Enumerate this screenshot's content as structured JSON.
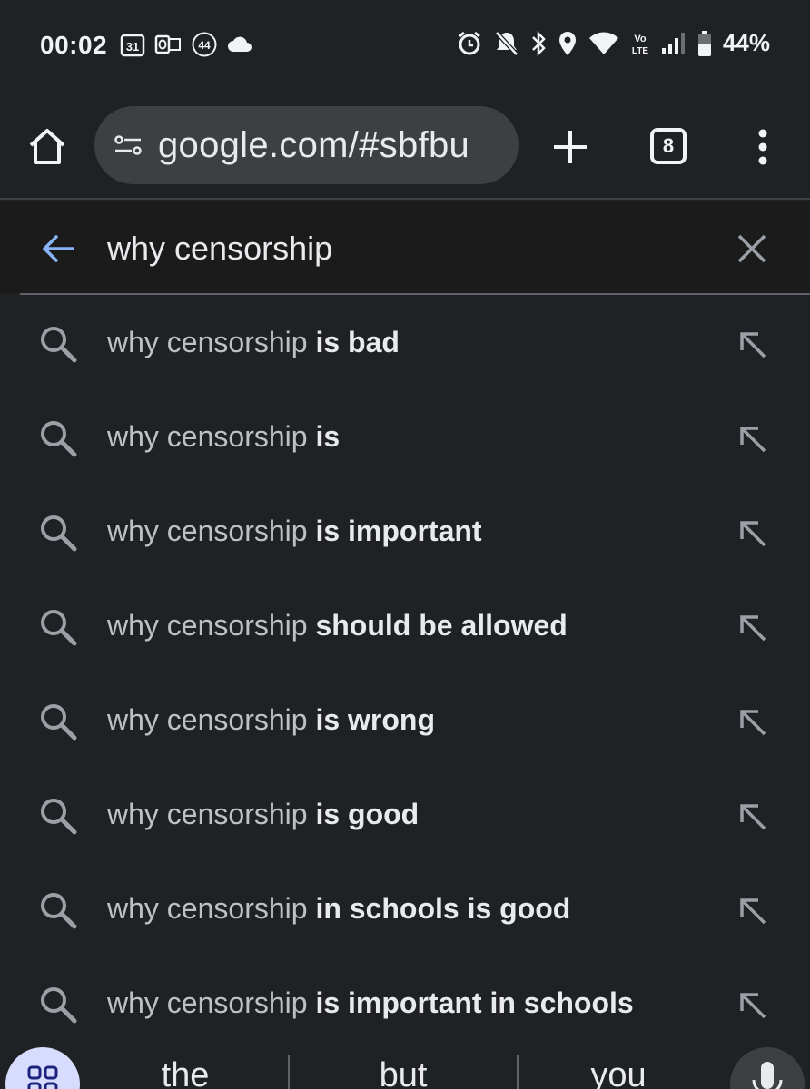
{
  "status_bar": {
    "time": "00:02",
    "calendar_day": "31",
    "notification_count": "44",
    "volte_top": "Vo",
    "volte_bottom": "LTE",
    "battery": "44%"
  },
  "toolbar": {
    "url": "google.com/#sbfbu",
    "tab_count": "8"
  },
  "search": {
    "query": "why censorship"
  },
  "suggestions": [
    {
      "prefix": "why censorship",
      "suffix": " is bad"
    },
    {
      "prefix": "why censorship",
      "suffix": " is"
    },
    {
      "prefix": "why censorship",
      "suffix": " is important"
    },
    {
      "prefix": "why censorship",
      "suffix": " should be allowed"
    },
    {
      "prefix": "why censorship",
      "suffix": " is wrong"
    },
    {
      "prefix": "why censorship",
      "suffix": " is good"
    },
    {
      "prefix": "why censorship",
      "suffix": " in schools is good"
    },
    {
      "prefix": "why censorship",
      "suffix": " is important in schools"
    }
  ],
  "keyboard": {
    "words": [
      "the",
      "but",
      "you"
    ]
  },
  "colors": {
    "background": "#202124",
    "url_bar": "#3c4043",
    "accent_back_arrow": "#8ab4f8",
    "apps_button": "#d7dcff"
  }
}
